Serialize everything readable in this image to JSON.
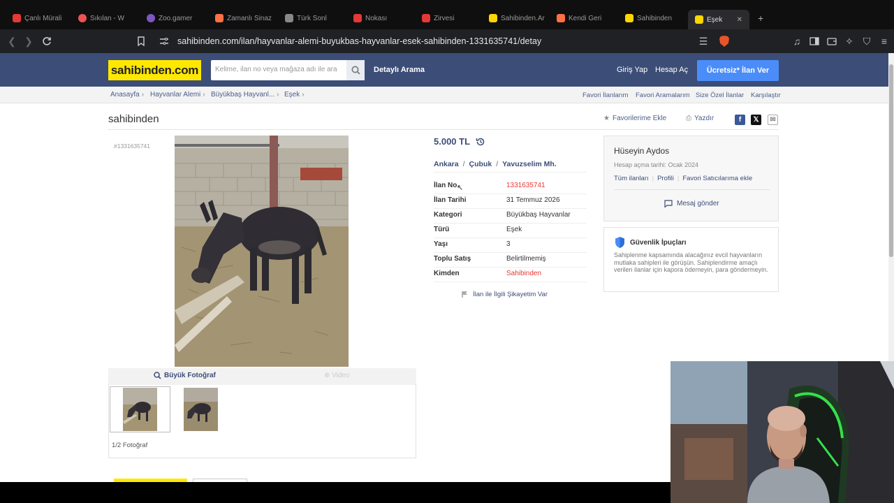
{
  "browser": {
    "tabs": [
      {
        "label": "Çanlı Mürali",
        "color": "#e53935"
      },
      {
        "label": "Sıkılan - W",
        "color": "#ef5350"
      },
      {
        "label": "Zoo.gamer",
        "color": "#7e57c2"
      },
      {
        "label": "Zamanlı Sinaz",
        "color": "#ff7043"
      },
      {
        "label": "Türk Sonl",
        "color": "#888888"
      },
      {
        "label": "Nokası",
        "color": "#e53935"
      },
      {
        "label": "Zirvesi",
        "color": "#e53935"
      },
      {
        "label": "Sahibinden.Ar",
        "color": "#ffd600"
      },
      {
        "label": "Kendi Geri",
        "color": "#ff7043"
      },
      {
        "label": "Sahibinden",
        "color": "#ffd600"
      },
      {
        "label": "Eşek",
        "color": "#ffd600"
      }
    ],
    "url": "sahibinden.com/ilan/hayvanlar-alemi-buyukbas-hayvanlar-esek-sahibinden-1331635741/detay"
  },
  "header": {
    "logo": "sahibinden.com",
    "search_placeholder": "Kelime, ilan no veya mağaza adı ile ara",
    "advanced_search": "Detaylı Arama",
    "login": "Giriş Yap",
    "register": "Hesap Aç",
    "post_ad": "Ücretsiz* İlan Ver"
  },
  "breadcrumb": {
    "items": [
      "Anasayfa",
      "Hayvanlar Alemi",
      "Büyükbaş Hayvanl...",
      "Eşek"
    ],
    "right_links": [
      "Favori İlanlarım",
      "Favori Aramalarım",
      "Size Özel İlanlar",
      "Karşılaştır"
    ]
  },
  "listing": {
    "title": "sahibinden",
    "add_favorite": "Favorilerime Ekle",
    "print": "Yazdır",
    "id_small": "#1331635741",
    "price": "5.000 TL",
    "location": [
      "Ankara",
      "Çubuk",
      "Yavuzselim Mh."
    ],
    "details": [
      {
        "key": "İlan No",
        "value": "1331635741",
        "color": "#e53935"
      },
      {
        "key": "İlan Tarihi",
        "value": "31 Temmuz 2026",
        "color": "#333333"
      },
      {
        "key": "Kategori",
        "value": "Büyükbaş Hayvanlar",
        "color": "#333333"
      },
      {
        "key": "Türü",
        "value": "Eşek",
        "color": "#333333"
      },
      {
        "key": "Yaşı",
        "value": "3",
        "color": "#333333"
      },
      {
        "key": "Toplu Satış",
        "value": "Belirtilmemiş",
        "color": "#333333"
      },
      {
        "key": "Kimden",
        "value": "Sahibinden",
        "color": "#e53935"
      }
    ],
    "complaint": "İlan ile İlgili Şikayetim Var"
  },
  "gallery": {
    "big_photo": "Büyük Fotoğraf",
    "video": "Video",
    "photo_count": "1/2 Fotoğraf"
  },
  "seller": {
    "name": "Hüseyin Aydos",
    "since": "Hesap açma tarihi: Ocak 2024",
    "links": [
      "Tüm ilanları",
      "Profili",
      "Favori Satıcılarıma ekle"
    ],
    "message": "Mesaj gönder"
  },
  "tips": {
    "title": "Güvenlik İpuçları",
    "text": "Sahiplenme kapsamında alacağınız evcil hayvanların mutlaka sahipleri ile görüşün. Sahiplendirme amaçlı verilen ilanlar için kapora ödemeyin, para göndermeyin."
  },
  "colors": {
    "brand_yellow": "#ffe800",
    "header_blue": "#3c4d77",
    "button_blue": "#4b8df8",
    "accent_red": "#e53935"
  }
}
